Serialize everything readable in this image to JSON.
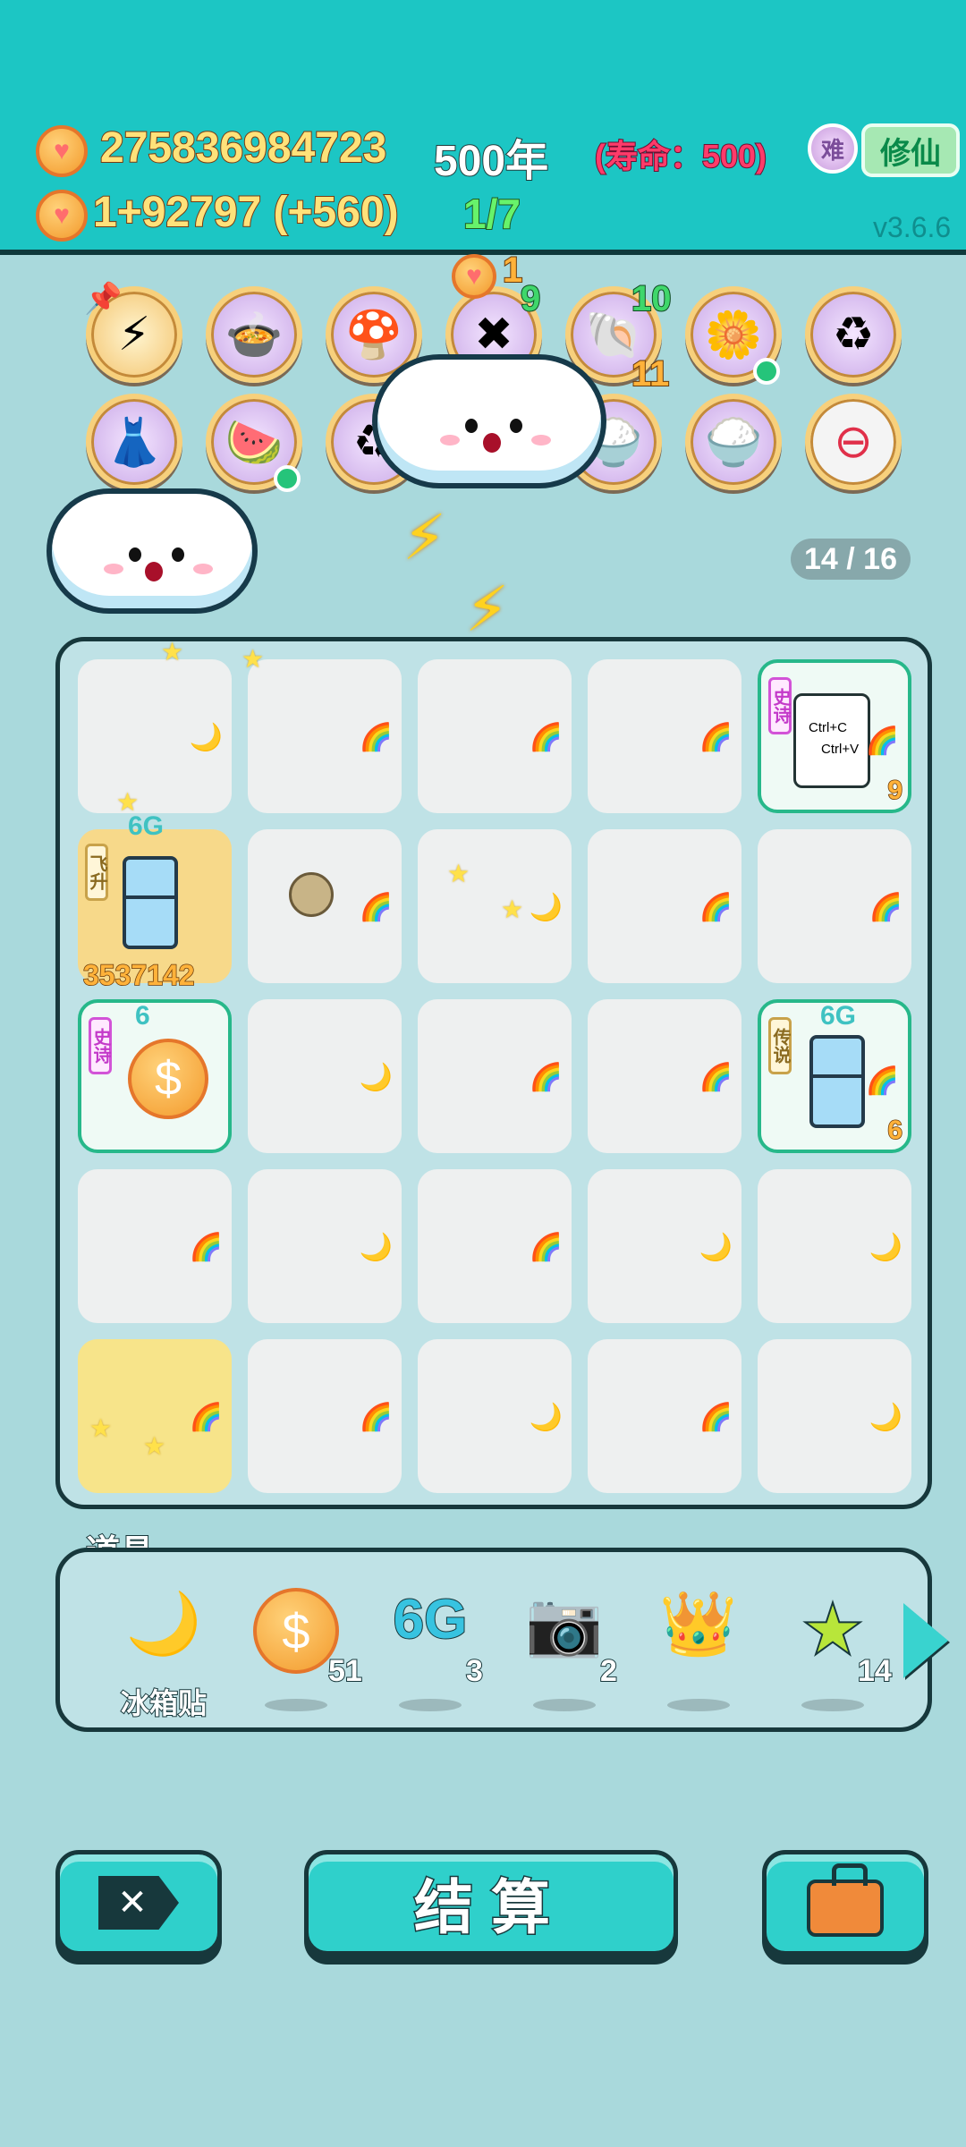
{
  "header": {
    "coins": "275836984723",
    "year": "500年",
    "lifespan": "(寿命：500)",
    "badge": "难",
    "cultivate_btn": "修仙",
    "income": "1+92797 (+560)",
    "progress": "1/7",
    "version": "v3.6.6"
  },
  "abilities": {
    "shell_top_count": "10",
    "shell_bottom_count": "11",
    "center_count_gold": "1",
    "center_count_green": "9"
  },
  "board": {
    "slot_counter": "14 / 16",
    "cells": {
      "r0c4": {
        "tag": "史诗",
        "text1": "Ctrl+C",
        "text2": "Ctrl+V",
        "count": "9"
      },
      "r1c0": {
        "tag": "飞升",
        "top": "6G",
        "count": "3537142"
      },
      "r2c0": {
        "tag": "史诗",
        "top": "6"
      },
      "r2c4": {
        "tag": "传说",
        "top": "6G",
        "count": "6"
      }
    }
  },
  "items": {
    "title": "道具",
    "list": [
      {
        "icon": "moon-sticker-icon",
        "name": "冰箱贴",
        "count": ""
      },
      {
        "icon": "coin-icon",
        "name": "",
        "count": "51"
      },
      {
        "icon": "6g-icon",
        "name": "",
        "count": "3",
        "label": "6G"
      },
      {
        "icon": "camera-icon",
        "name": "",
        "count": "2"
      },
      {
        "icon": "crown-icon",
        "name": "",
        "count": ""
      },
      {
        "icon": "star-icon",
        "name": "",
        "count": "14"
      }
    ]
  },
  "buttons": {
    "settle": "结算"
  },
  "colors": {
    "header_bg": "#1cc6c4",
    "page_bg": "#a9d9dc",
    "accent": "#2fd0cb"
  }
}
